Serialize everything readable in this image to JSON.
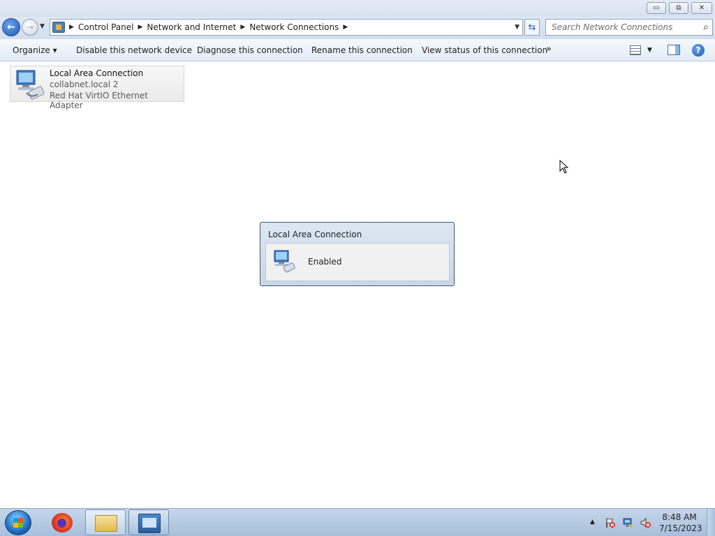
{
  "window": {
    "minimize": "▭",
    "maximize": "⧉",
    "close": "✕"
  },
  "address": {
    "back": "←",
    "forward": "→",
    "breadcrumbs": [
      "Control Panel",
      "Network and Internet",
      "Network Connections"
    ],
    "search_placeholder": "Search Network Connections"
  },
  "toolbar": {
    "organize": "Organize ▾",
    "disable": "Disable this network device",
    "diagnose": "Diagnose this connection",
    "rename": "Rename this connection",
    "view_status": "View status of this connection",
    "more": "»",
    "help": "?"
  },
  "connection": {
    "name": "Local Area Connection",
    "network": "collabnet.local  2",
    "adapter": "Red Hat VirtIO Ethernet Adapter"
  },
  "popup": {
    "title": "Local Area Connection",
    "status": "Enabled"
  },
  "taskbar": {
    "time": "8:48 AM",
    "date": "7/15/2023",
    "pinned": [
      "firefox-icon",
      "folder-icon",
      "network-connections-icon"
    ]
  },
  "colors": {
    "accent": "#1f5db3",
    "taskbar": "#b6cbe3",
    "command_bar": "#e2ebf6"
  }
}
